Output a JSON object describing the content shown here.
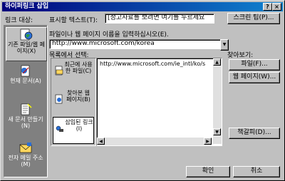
{
  "title": "하이퍼링크 삽입",
  "title_buttons": {
    "help": "?",
    "close": "×"
  },
  "link_target_label": "링크 대상:",
  "display_text": {
    "label": "표시할 텍스트(T):",
    "value": "[정고사료를 보려면 여기를 누르세요",
    "button": "스크린 팁(P)..."
  },
  "address": {
    "label": "파일이나 웹 페이지 이름을 입력하십시오(E).",
    "value": "http://www.microsoft.com/korea"
  },
  "list_label": "목록에서 선택:",
  "browse_label": "찾아보기:",
  "browse_buttons": [
    "파일(F)...",
    "웹 페이지(W)...",
    "책갈피(D)..."
  ],
  "sidebar": {
    "items": [
      {
        "label": "기존 파일/웹 페이지(X)",
        "icon": "globe-file-icon",
        "selected": true
      },
      {
        "label": "현재 문서(A)",
        "icon": "document-icon",
        "selected": false
      },
      {
        "label": "새 문서 만들기(N)",
        "icon": "new-document-icon",
        "selected": false
      },
      {
        "label": "전자 메일 주소(M)",
        "icon": "email-icon",
        "selected": false
      }
    ]
  },
  "subnav": {
    "items": [
      {
        "label": "최근에 사용한 파일(C)",
        "selected": false
      },
      {
        "label": "찾아본 웹 페이지(B)",
        "selected": false
      },
      {
        "label": "삽입된 링크(I)",
        "selected": true
      }
    ]
  },
  "list_items": [
    "http://www.microsoft.com/ie_intl/ko/s"
  ],
  "footer": {
    "ok": "확인",
    "cancel": "취소"
  }
}
